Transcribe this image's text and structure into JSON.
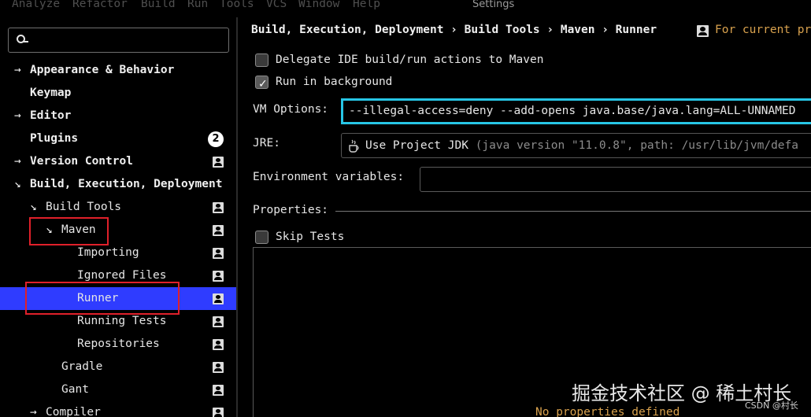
{
  "menubar": {
    "items": [
      "Analyze",
      "Refactor",
      "Build",
      "Run",
      "Tools",
      "VCS",
      "Window",
      "Help"
    ],
    "window_title": "Settings"
  },
  "sidebar": {
    "search": {
      "value": "",
      "placeholder": ""
    },
    "items": [
      {
        "label": "Appearance & Behavior",
        "arrow": "→",
        "bold": true
      },
      {
        "label": "Keymap",
        "arrow": "",
        "bold": true
      },
      {
        "label": "Editor",
        "arrow": "→",
        "bold": true
      },
      {
        "label": "Plugins",
        "arrow": "",
        "bold": true,
        "badge": "2"
      },
      {
        "label": "Version Control",
        "arrow": "→",
        "bold": true,
        "icon": "project-settings-icon"
      },
      {
        "label": "Build, Execution, Deployment",
        "arrow": "↘",
        "bold": true
      },
      {
        "label": "Build Tools",
        "arrow": "↘",
        "bold": false,
        "icon": "project-settings-icon"
      },
      {
        "label": "Maven",
        "arrow": "↘",
        "bold": false,
        "icon": "project-settings-icon"
      },
      {
        "label": "Importing",
        "arrow": "",
        "bold": false,
        "icon": "project-settings-icon"
      },
      {
        "label": "Ignored Files",
        "arrow": "",
        "bold": false,
        "icon": "project-settings-icon"
      },
      {
        "label": "Runner",
        "arrow": "",
        "bold": false,
        "icon": "project-settings-icon",
        "selected": true
      },
      {
        "label": "Running Tests",
        "arrow": "",
        "bold": false,
        "icon": "project-settings-icon"
      },
      {
        "label": "Repositories",
        "arrow": "",
        "bold": false,
        "icon": "project-settings-icon"
      },
      {
        "label": "Gradle",
        "arrow": "",
        "bold": false,
        "icon": "project-settings-icon"
      },
      {
        "label": "Gant",
        "arrow": "",
        "bold": false,
        "icon": "project-settings-icon"
      },
      {
        "label": "Compiler",
        "arrow": "→",
        "bold": false,
        "icon": "project-settings-icon"
      }
    ]
  },
  "panel": {
    "breadcrumb": "Build, Execution, Deployment › Build Tools › Maven › Runner",
    "scope": "For current pr",
    "delegate": {
      "label": "Delegate IDE build/run actions to Maven",
      "checked": false
    },
    "background": {
      "label": "Run in background",
      "checked": true
    },
    "vm_options": {
      "label": "VM Options:",
      "value": "--illegal-access=deny --add-opens java.base/java.lang=ALL-UNNAMED"
    },
    "jre": {
      "label": "JRE:",
      "value": "Use Project JDK",
      "hint": "(java version \"11.0.8\", path: /usr/lib/jvm/defa"
    },
    "env": {
      "label": "Environment variables:",
      "value": ""
    },
    "properties": {
      "label": "Properties:",
      "empty_text": "No properties defined"
    },
    "skip_tests": {
      "label": "Skip Tests",
      "checked": false
    }
  },
  "watermark": {
    "main": "掘金技术社区 @ 稀土村长",
    "small": "CSDN @村长"
  },
  "colors": {
    "selection": "#2f3cff",
    "focus_border": "#27c6e6",
    "highlight_box": "#e0202a",
    "scope_text": "#d9a24e"
  }
}
